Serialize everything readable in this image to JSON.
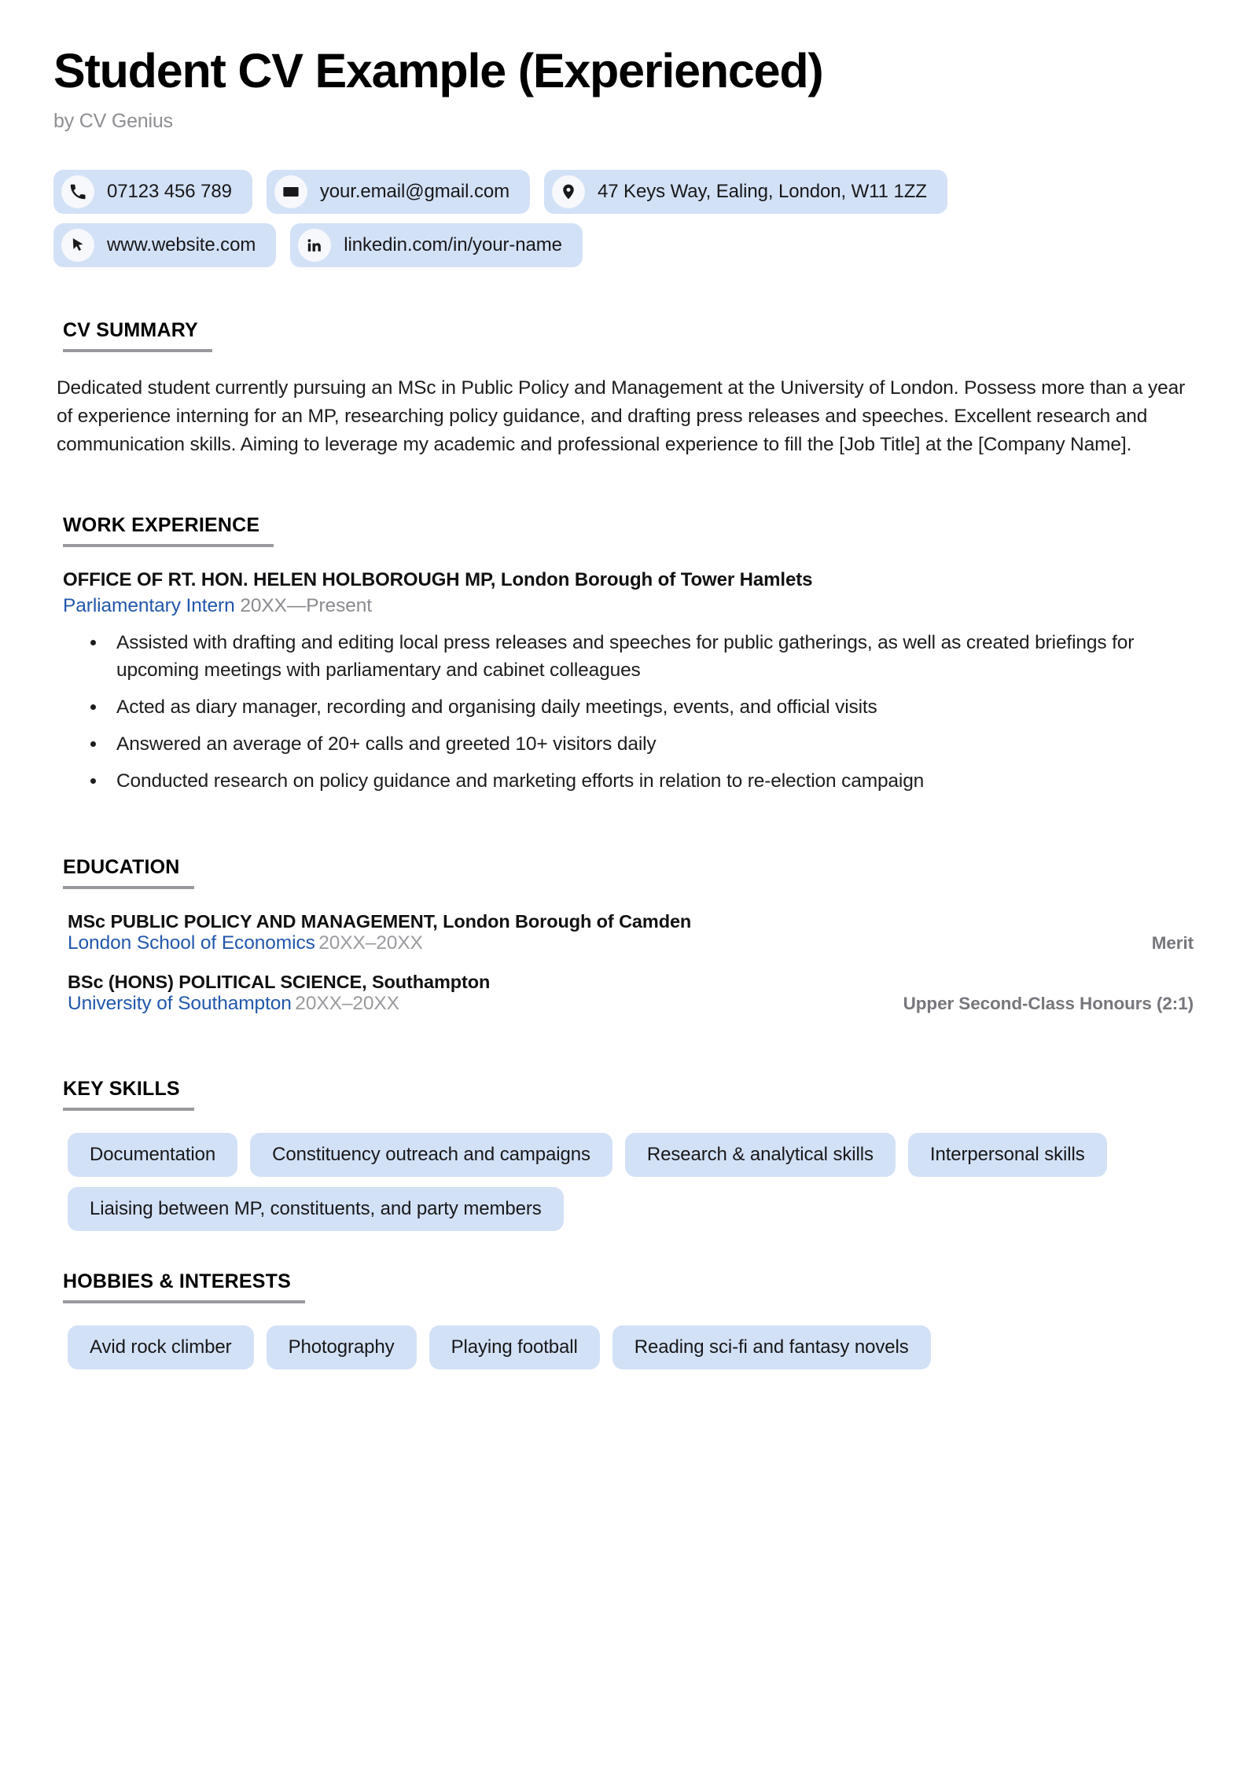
{
  "header": {
    "title": "Student CV Example (Experienced)",
    "byline": "by CV Genius"
  },
  "contact": {
    "rows": [
      [
        {
          "icon": "phone-icon",
          "text": "07123 456 789"
        },
        {
          "icon": "email-icon",
          "text": "your.email@gmail.com"
        },
        {
          "icon": "location-pin-icon",
          "text": "47 Keys Way, Ealing, London, W11 1ZZ"
        }
      ],
      [
        {
          "icon": "cursor-pointer-icon",
          "text": "www.website.com"
        },
        {
          "icon": "linkedin-icon",
          "text": "linkedin.com/in/your-name"
        }
      ]
    ]
  },
  "sections": {
    "summary": {
      "heading": "CV SUMMARY",
      "text": "Dedicated student currently pursuing an MSc in Public Policy and Management at the University of London. Possess more than a year of experience interning for an MP, researching policy guidance, and drafting press releases and speeches. Excellent research and communication skills. Aiming to leverage my academic and professional experience to fill the [Job Title] at the [Company Name]."
    },
    "work": {
      "heading": "WORK EXPERIENCE",
      "jobs": [
        {
          "organisation": "OFFICE OF RT. HON. HELEN HOLBOROUGH MP, London Borough of Tower Hamlets",
          "role": "Parliamentary Intern",
          "dates": "20XX—Present",
          "bullets": [
            "Assisted with drafting and editing local press releases and speeches for public gatherings, as well as created briefings for upcoming meetings with parliamentary and cabinet colleagues",
            "Acted as diary manager, recording and organising daily meetings, events, and official visits",
            "Answered an average of 20+ calls and greeted 10+ visitors daily",
            "Conducted research on policy guidance and marketing efforts in relation to re-election campaign"
          ]
        }
      ]
    },
    "education": {
      "heading": "EDUCATION",
      "items": [
        {
          "degree": "MSc PUBLIC POLICY AND MANAGEMENT, London Borough of Camden",
          "school": "London School of Economics",
          "dates": "20XX–20XX",
          "grade": "Merit"
        },
        {
          "degree": "BSc (HONS) POLITICAL SCIENCE, Southampton",
          "school": "University of Southampton",
          "dates": "20XX–20XX",
          "grade": "Upper Second-Class Honours (2:1)"
        }
      ]
    },
    "skills": {
      "heading": "KEY SKILLS",
      "items": [
        "Documentation",
        "Constituency outreach and campaigns",
        "Research & analytical skills",
        "Interpersonal skills",
        "Liaising between MP, constituents, and party members"
      ]
    },
    "hobbies": {
      "heading": "HOBBIES & INTERESTS",
      "items": [
        "Avid rock climber",
        "Photography",
        "Playing football",
        "Reading sci-fi and fantasy novels"
      ]
    }
  },
  "colors": {
    "chip_background": "#d3e1f7",
    "link_blue": "#2257ab",
    "muted_grey": "#8e8e93",
    "rule_grey": "#9a9a9e"
  }
}
